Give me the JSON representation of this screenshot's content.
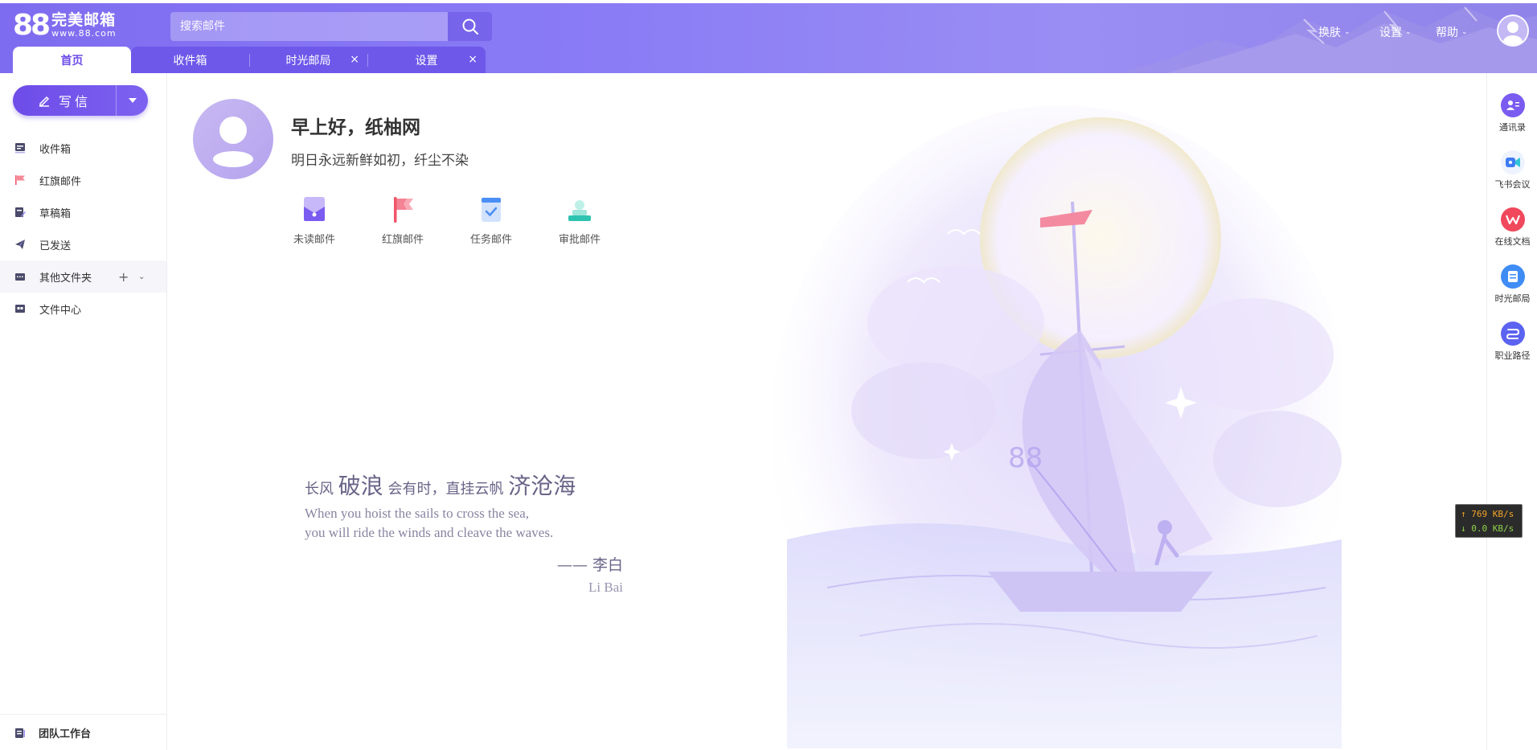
{
  "header": {
    "logo_mark": "88",
    "logo_name": "完美邮箱",
    "logo_url": "www.88.com",
    "search_placeholder": "搜索邮件",
    "tabs": [
      {
        "label": "首页"
      },
      {
        "label": "收件箱"
      },
      {
        "label": "时光邮局",
        "close": "×"
      },
      {
        "label": "设置",
        "close": "×"
      }
    ],
    "nav": [
      {
        "label": "换肤"
      },
      {
        "label": "设置"
      },
      {
        "label": "帮助"
      }
    ]
  },
  "sidebar": {
    "compose_label": "写信",
    "items": [
      {
        "label": "收件箱",
        "icon": "inbox-icon"
      },
      {
        "label": "红旗邮件",
        "icon": "red-flag-icon"
      },
      {
        "label": "草稿箱",
        "icon": "draft-icon"
      },
      {
        "label": "已发送",
        "icon": "send-icon"
      },
      {
        "label": "其他文件夹",
        "icon": "folder-icon"
      },
      {
        "label": "文件中心",
        "icon": "file-center-icon"
      }
    ],
    "team_label": "团队工作台"
  },
  "main": {
    "greeting": "早上好，纸柚网",
    "motto": "明日永远新鲜如初，纤尘不染",
    "quick_actions": [
      {
        "label": "未读邮件",
        "color": "#7b5cf0"
      },
      {
        "label": "红旗邮件",
        "color": "#f0556a"
      },
      {
        "label": "任务邮件",
        "color": "#4a8ff5"
      },
      {
        "label": "审批邮件",
        "color": "#2ec3b0"
      }
    ],
    "poem": {
      "p1": "长风",
      "p2": "破浪",
      "p3": "会有时，直挂云帆",
      "p4": "济沧海",
      "en1": "When you hoist the sails to cross the sea,",
      "en2": "you will ride the winds and cleave the waves.",
      "author": "—— 李白",
      "author_en": "Li Bai"
    }
  },
  "rail": {
    "items": [
      {
        "label": "通讯录",
        "color": "#7b5cf0"
      },
      {
        "label": "飞书会议",
        "color": "#3f7cf5"
      },
      {
        "label": "在线文档",
        "color": "#f0485c"
      },
      {
        "label": "时光邮局",
        "color": "#3f8cf5"
      },
      {
        "label": "职业路径",
        "color": "#5b63f0"
      }
    ]
  },
  "netspeed": {
    "up": "↑ 769 KB/s",
    "down": "↓ 0.0 KB/s"
  },
  "colors": {
    "accent": "#6d4ce8",
    "header_bg": "#8a7cf5"
  }
}
